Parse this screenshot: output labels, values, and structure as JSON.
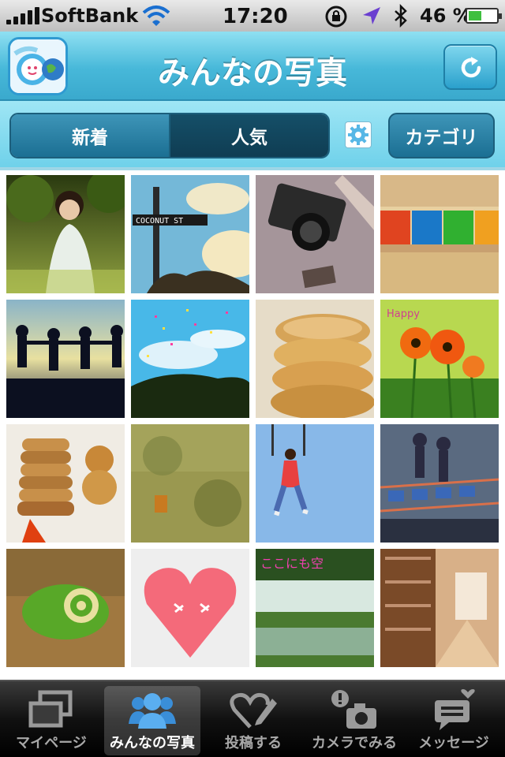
{
  "status_bar": {
    "carrier": "SoftBank",
    "time": "17:20",
    "battery_text": "46 %",
    "battery_level": 0.46
  },
  "nav": {
    "title": "みんなの写真",
    "logo_icon": "camera-earth-logo",
    "refresh_icon": "refresh-icon"
  },
  "toolbar": {
    "segments": [
      {
        "label": "新着",
        "selected": false
      },
      {
        "label": "人気",
        "selected": true
      }
    ],
    "filter_icon": "gear-icon",
    "category_label": "カテゴリ"
  },
  "photos": [
    {
      "subject": "child-in-park"
    },
    {
      "subject": "coconut-st-sign",
      "overlay_text": "COCONUT ST"
    },
    {
      "subject": "vintage-camera"
    },
    {
      "subject": "colorful-chairs"
    },
    {
      "subject": "people-silhouettes-beach"
    },
    {
      "subject": "sky-confetti"
    },
    {
      "subject": "pancake-stack-closeup"
    },
    {
      "subject": "orange-poppies",
      "overlay_text": "Happy"
    },
    {
      "subject": "pancakes-with-bear"
    },
    {
      "subject": "grass-field"
    },
    {
      "subject": "child-swing-sky"
    },
    {
      "subject": "shadows-on-rails"
    },
    {
      "subject": "green-swiss-roll"
    },
    {
      "subject": "pink-heart-candy"
    },
    {
      "subject": "forest-reflection",
      "overlay_text": "ここにも空"
    },
    {
      "subject": "library-bookshelves"
    }
  ],
  "tabbar": {
    "items": [
      {
        "label": "マイページ",
        "icon": "windows-icon",
        "active": false
      },
      {
        "label": "みんなの写真",
        "icon": "people-icon",
        "active": true
      },
      {
        "label": "投稿する",
        "icon": "heart-pen-icon",
        "active": false
      },
      {
        "label": "カメラでみる",
        "icon": "camera-alert-icon",
        "active": false
      },
      {
        "label": "メッセージ",
        "icon": "message-heart-icon",
        "active": false
      }
    ]
  },
  "colors": {
    "nav_blue": "#47b8d9",
    "toolbar_blue": "#6fd1ea",
    "segment_active": "#0f3d53"
  }
}
